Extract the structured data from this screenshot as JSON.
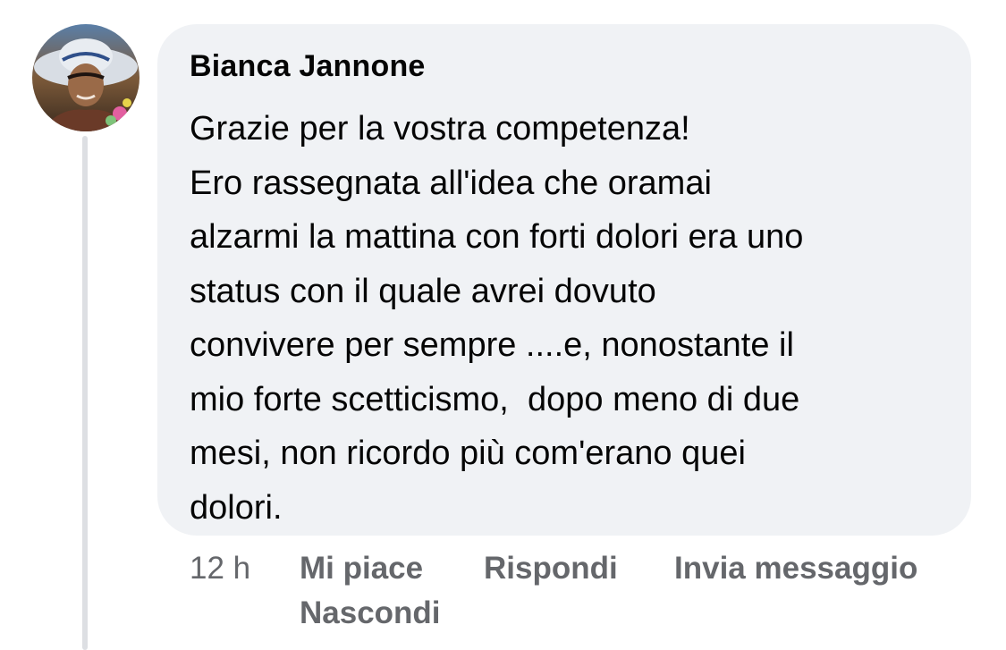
{
  "comment": {
    "author": "Bianca Jannone",
    "text_lines": [
      "Grazie per la vostra competenza!",
      "Ero rassegnata all'idea che oramai",
      "alzarmi la mattina con forti dolori era uno",
      "status con il quale avrei dovuto",
      "convivere per sempre ....e, nonostante il",
      "mio forte scetticismo,  dopo meno di due",
      "mesi, non ricordo più com'erano quei",
      "dolori."
    ],
    "timestamp": "12 h",
    "actions": {
      "like": "Mi piace",
      "reply": "Rispondi",
      "message": "Invia messaggio",
      "hide": "Nascondi"
    }
  },
  "colors": {
    "bubble": "#f0f2f5",
    "text": "#050505",
    "secondary": "#65676b",
    "thread_line": "#dddfe3"
  }
}
